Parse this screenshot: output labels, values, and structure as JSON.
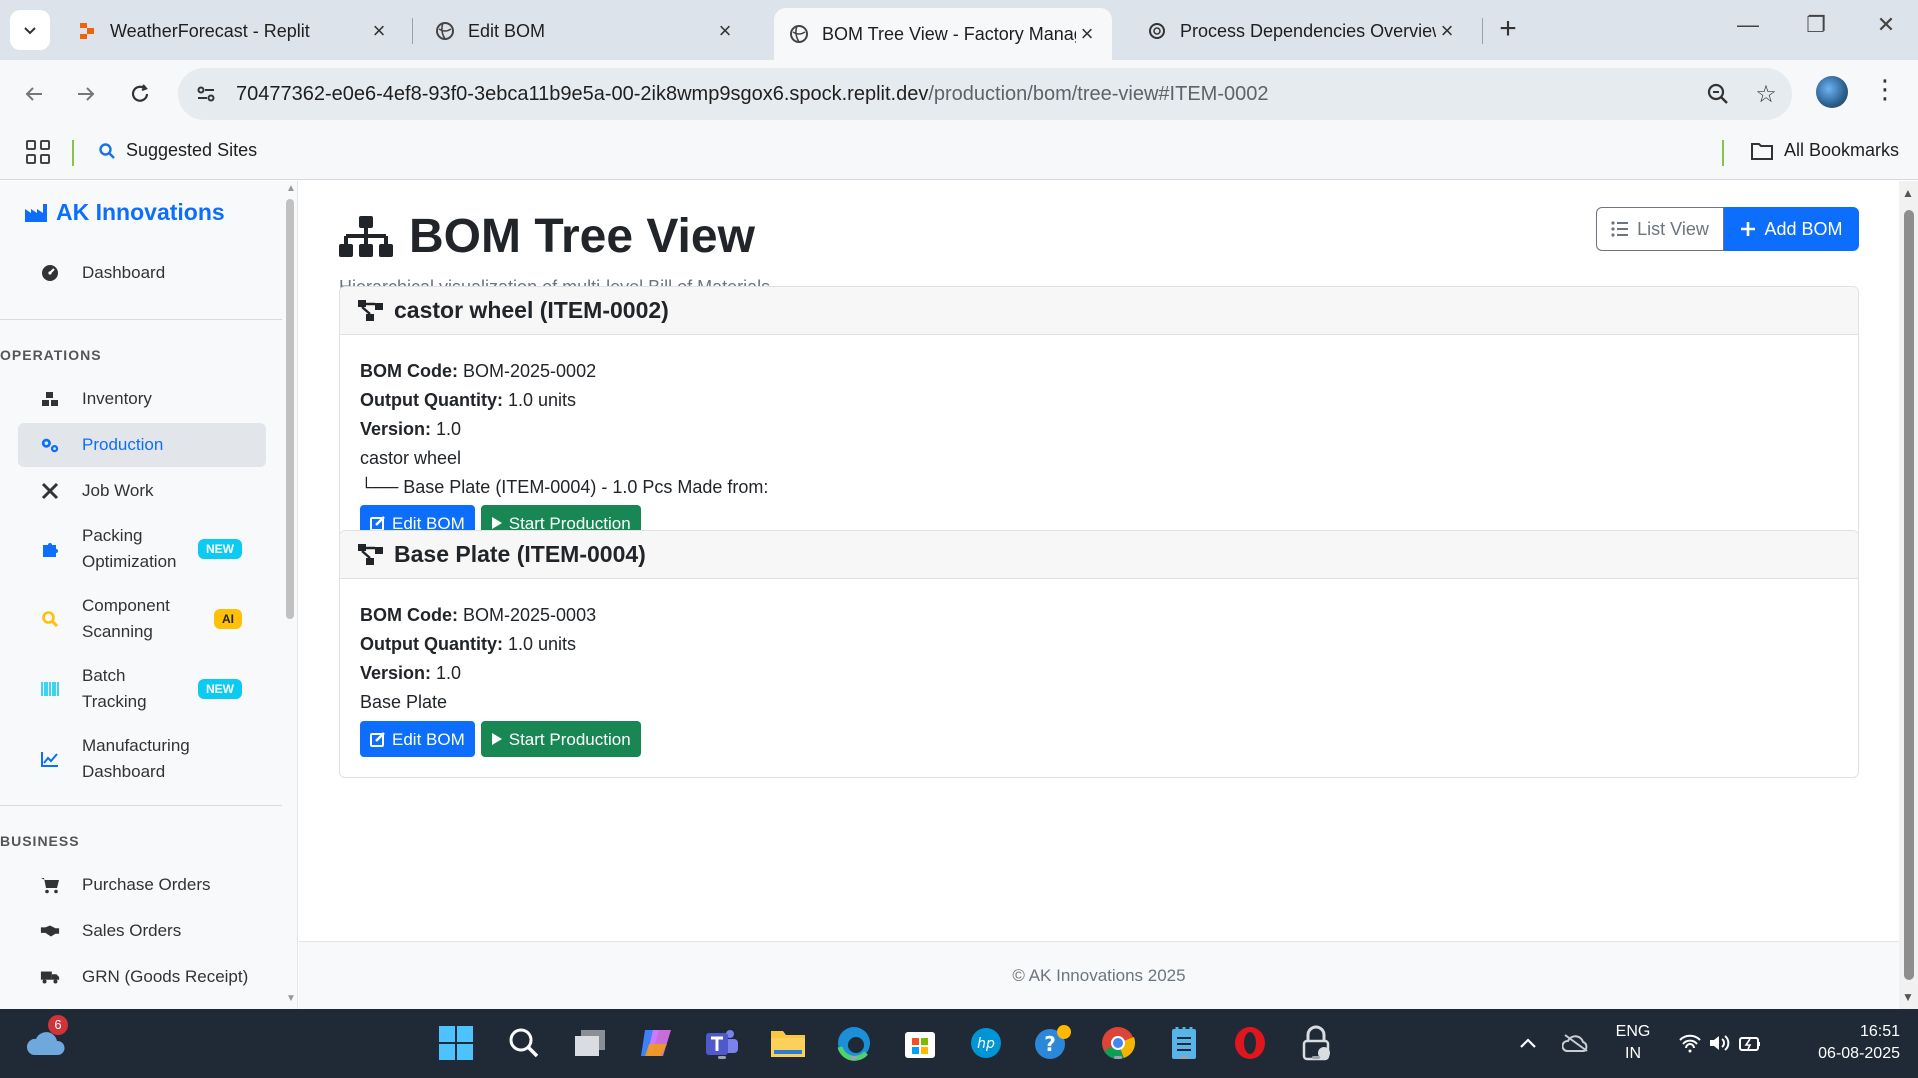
{
  "browser": {
    "tabs": [
      {
        "title": "WeatherForecast - Replit",
        "active": false
      },
      {
        "title": "Edit BOM",
        "active": false
      },
      {
        "title": "BOM Tree View - Factory Manag",
        "active": true
      },
      {
        "title": "Process Dependencies Overview",
        "active": false
      }
    ],
    "url_host": "70477362-e0e6-4ef8-93f0-3ebca11b9e5a-00-2ik8wmp9sgox6.spock.replit.dev",
    "url_path": "/production/bom/tree-view#ITEM-0002",
    "bookmarks": {
      "suggested": "Suggested Sites",
      "all": "All Bookmarks"
    }
  },
  "sidebar": {
    "brand": "AK Innovations",
    "dashboard": "Dashboard",
    "operations_header": "OPERATIONS",
    "operations": [
      {
        "label": "Inventory",
        "icon": "boxes-icon"
      },
      {
        "label": "Production",
        "icon": "cogs-icon",
        "active": true
      },
      {
        "label": "Job Work",
        "icon": "tools-icon"
      },
      {
        "label": "Packing Optimization",
        "line1": "Packing",
        "line2": "Optimization",
        "badge": "NEW"
      },
      {
        "label": "Component Scanning",
        "line1": "Component",
        "line2": "Scanning",
        "badge": "AI"
      },
      {
        "label": "Batch Tracking",
        "line1": "Batch",
        "line2": "Tracking",
        "badge": "NEW"
      },
      {
        "label": "Manufacturing Dashboard",
        "line1": "Manufacturing",
        "line2": "Dashboard"
      }
    ],
    "business_header": "BUSINESS",
    "business": [
      {
        "label": "Purchase Orders"
      },
      {
        "label": "Sales Orders"
      },
      {
        "label": "GRN (Goods Receipt)"
      }
    ]
  },
  "main": {
    "title": "BOM Tree View",
    "subtitle": "Hierarchical visualization of multi-level Bill of Materials",
    "list_view": "List View",
    "add_bom": "Add BOM",
    "labels": {
      "bom_code": "BOM Code:",
      "output_qty": "Output Quantity:",
      "version": "Version:"
    },
    "boms": [
      {
        "header": "castor wheel (ITEM-0002)",
        "bom_code": "BOM-2025-0002",
        "output_qty": "1.0 units",
        "version": "1.0",
        "name": "castor wheel",
        "child": "└── Base Plate (ITEM-0004) - 1.0 Pcs Made from:",
        "edit": "Edit BOM",
        "start": "Start Production"
      },
      {
        "header": "Base Plate (ITEM-0004)",
        "bom_code": "BOM-2025-0003",
        "output_qty": "1.0 units",
        "version": "1.0",
        "name": "Base Plate",
        "edit": "Edit BOM",
        "start": "Start Production"
      }
    ],
    "footer": "© AK Innovations 2025"
  },
  "taskbar": {
    "weather_badge": "6",
    "lang_line1": "ENG",
    "lang_line2": "IN",
    "time": "16:51",
    "date": "06-08-2025"
  },
  "colors": {
    "primary": "#0d6efd",
    "success": "#198754",
    "info": "#0dcaf0",
    "warning": "#ffc107"
  }
}
